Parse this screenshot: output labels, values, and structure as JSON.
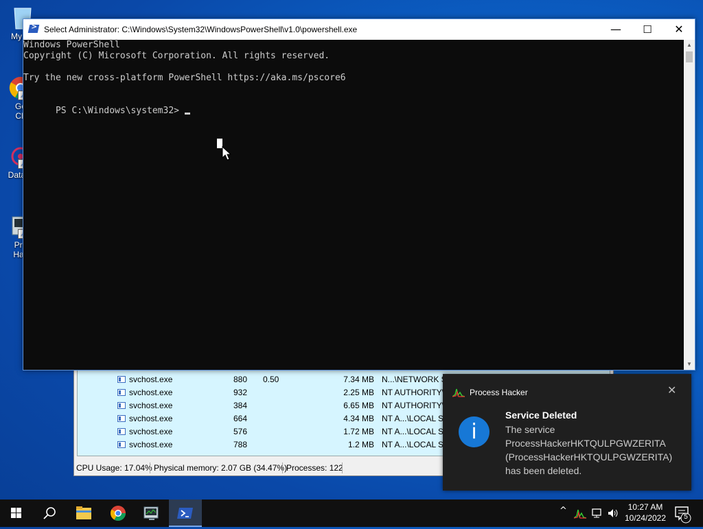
{
  "desktop": {
    "icons": [
      {
        "label_line1": "My C",
        "label_line2": ""
      },
      {
        "label_line1": "Go",
        "label_line2": "Ch"
      },
      {
        "label_line1": "DataW",
        "label_line2": ""
      },
      {
        "label_line1": "Pro",
        "label_line2": "Hac"
      }
    ]
  },
  "powershell": {
    "title": "Select Administrator: C:\\Windows\\System32\\WindowsPowerShell\\v1.0\\powershell.exe",
    "lines": [
      "Windows PowerShell",
      "Copyright (C) Microsoft Corporation. All rights reserved.",
      "",
      "Try the new cross-platform PowerShell https://aka.ms/pscore6",
      "",
      "PS C:\\Windows\\system32> "
    ],
    "minimize_glyph": "—",
    "maximize_glyph": "☐",
    "close_glyph": "✕"
  },
  "process_hacker": {
    "rows": [
      {
        "name": "svchost.exe",
        "pid": "880",
        "cpu": "0.50",
        "mem": "7.34 MB",
        "user": "N...\\NETWORK SE"
      },
      {
        "name": "svchost.exe",
        "pid": "932",
        "cpu": "",
        "mem": "2.25 MB",
        "user": "NT AUTHORITY\\S"
      },
      {
        "name": "svchost.exe",
        "pid": "384",
        "cpu": "",
        "mem": "6.65 MB",
        "user": "NT AUTHORITY\\S"
      },
      {
        "name": "svchost.exe",
        "pid": "664",
        "cpu": "",
        "mem": "4.34 MB",
        "user": "NT A...\\LOCAL SE"
      },
      {
        "name": "svchost.exe",
        "pid": "576",
        "cpu": "",
        "mem": "1.72 MB",
        "user": "NT A...\\LOCAL SE"
      },
      {
        "name": "svchost.exe",
        "pid": "788",
        "cpu": "",
        "mem": "1.2 MB",
        "user": "NT A...\\LOCAL SE"
      }
    ],
    "status": {
      "cpu": "CPU Usage: 17.04%",
      "memory": "Physical memory: 2.07 GB (34.47%)",
      "processes": "Processes: 122"
    }
  },
  "toast": {
    "app_name": "Process Hacker",
    "heading": "Service Deleted",
    "body_lines": [
      "The service",
      "ProcessHackerHKTQULPGWZERITA",
      "(ProcessHackerHKTQULPGWZERITA)",
      "has been deleted."
    ],
    "info_glyph": "i",
    "close_glyph": "✕"
  },
  "taskbar": {
    "clock_time": "10:27 AM",
    "clock_date": "10/24/2022",
    "notification_count": "5",
    "tray_chevron": "^"
  },
  "colors": {
    "console_bg": "#0c0c0c",
    "console_text": "#cccccc",
    "ph_list_bg": "#d6f5ff",
    "toast_bg": "#1f1f1f",
    "info_blue": "#1778d6",
    "taskbar_bg": "#101010"
  }
}
